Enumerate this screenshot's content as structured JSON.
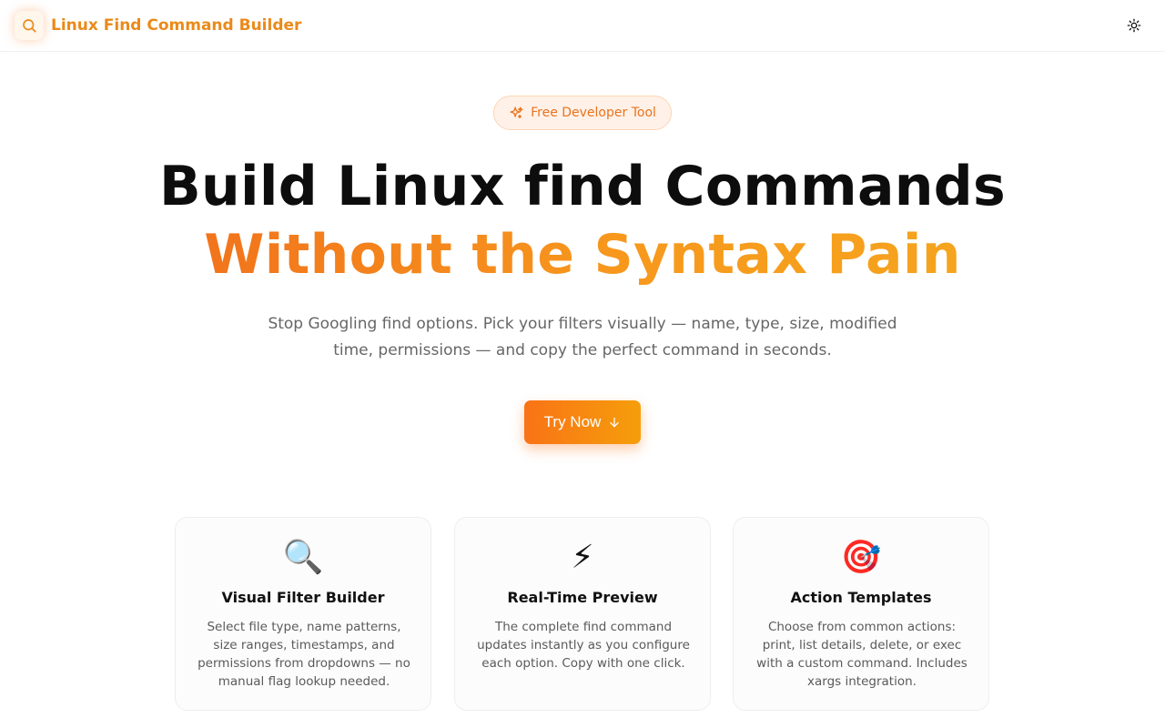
{
  "header": {
    "logo_icon": "search-icon",
    "brand": "Linux Find Command Builder",
    "theme_icon": "sun-icon",
    "accent": "#ea8a1a"
  },
  "badge": {
    "icon": "sparkles-icon",
    "label": "Free Developer Tool"
  },
  "hero": {
    "line1": "Build Linux find Commands",
    "line2": "Without the Syntax Pain",
    "subtitle": "Stop Googling find options. Pick your filters visually — name, type, size, modified time, permissions — and copy the perfect command in seconds."
  },
  "cta": {
    "label": "Try Now",
    "icon": "arrow-down-icon",
    "gradient": [
      "#f97316",
      "#f59e0b"
    ]
  },
  "features": [
    {
      "icon": "🔍",
      "icon_name": "magnifier-icon",
      "title": "Visual Filter Builder",
      "desc": "Select file type, name patterns, size ranges, timestamps, and permissions from dropdowns — no manual flag lookup needed."
    },
    {
      "icon": "⚡",
      "icon_name": "lightning-icon",
      "title": "Real-Time Preview",
      "desc": "The complete find command updates instantly as you configure each option. Copy with one click."
    },
    {
      "icon": "🎯",
      "icon_name": "target-icon",
      "title": "Action Templates",
      "desc": "Choose from common actions: print, list details, delete, or exec with a custom command. Includes xargs integration."
    }
  ]
}
